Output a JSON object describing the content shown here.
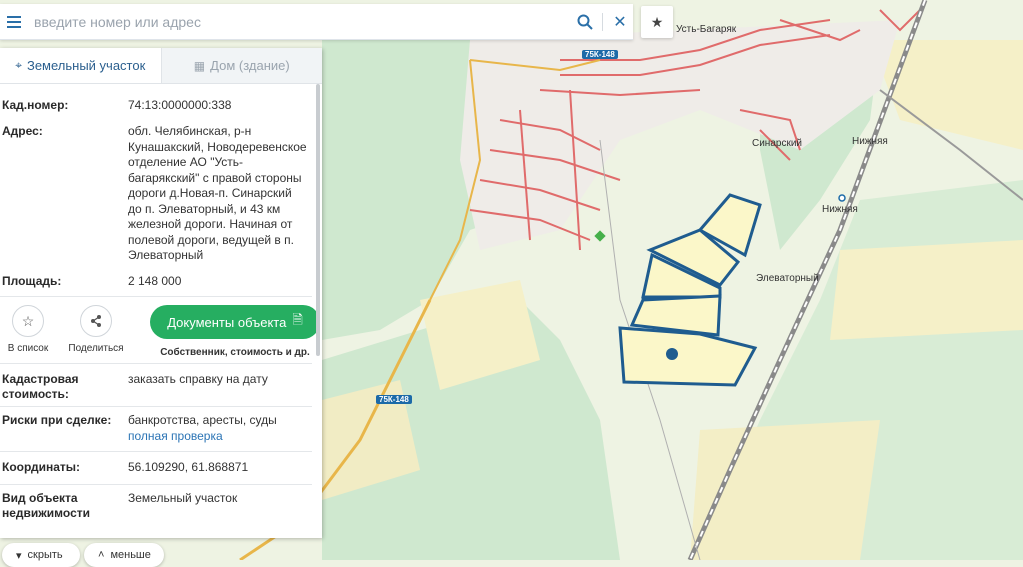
{
  "search": {
    "placeholder": "введите номер или адрес"
  },
  "icons": {
    "menu": "menu-icon",
    "search": "search-icon",
    "clear": "close-icon",
    "favorite": "star-icon"
  },
  "tabs": [
    {
      "label": "Земельный участок",
      "icon": "map-pin-icon",
      "active": true
    },
    {
      "label": "Дом (здание)",
      "icon": "building-icon",
      "active": false
    }
  ],
  "details": {
    "cadastral_number": {
      "label": "Кад.номер:",
      "value": "74:13:0000000:338"
    },
    "address": {
      "label": "Адрес:",
      "value": "обл. Челябинская, р-н Кунашакский, Новодеревенское отделение АО \"Усть-багарякский\" с правой стороны дороги д.Новая-п. Синарский до п. Элеваторный, и 43 км железной дороги. Начиная от полевой дороги, ведущей в п. Элеваторный"
    },
    "area": {
      "label": "Площадь:",
      "value": "2 148 000"
    },
    "cadastral_value": {
      "label": "Кадастровая стоимость:",
      "link": "заказать справку на дату"
    },
    "risks": {
      "label": "Риски при сделке:",
      "value": "банкротства, аресты, суды",
      "link": "полная проверка"
    },
    "coordinates": {
      "label": "Координаты:",
      "value": "56.109290, 61.868871"
    },
    "object_type": {
      "label": "Вид объекта недвижимости",
      "value": "Земельный участок"
    }
  },
  "actions": {
    "to_list": "В список",
    "share": "Поделиться",
    "documents": "Документы объекта",
    "documents_caption": "Собственник, стоимость и др."
  },
  "bottom": {
    "hide": "скрыть",
    "less": "меньше"
  },
  "map_labels": {
    "ust_bagaryak": "Усть-Багаряк",
    "nizhnyaya_1": "Нижняя",
    "nizhnyaya_2": "Нижняя",
    "sinarsky": "Синарский",
    "elevatorny": "Элеваторный",
    "road_1": "75К-148",
    "road_2": "75К-148"
  },
  "colors": {
    "accent": "#2a6fa8",
    "button_green": "#26ae61",
    "parcel_outline": "#1f5c8f",
    "parcel_fill": "#fbf7c9",
    "building_outline": "#e06b6b",
    "forest": "#cfe8cf",
    "field": "#f5f0c8"
  }
}
